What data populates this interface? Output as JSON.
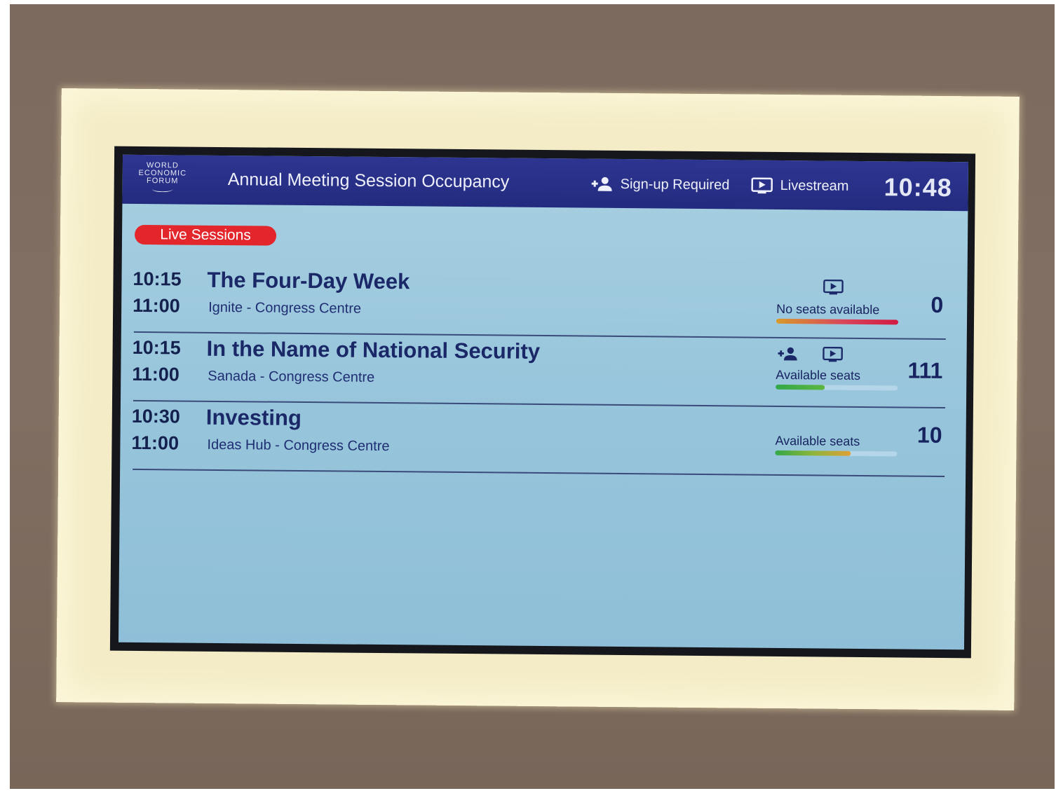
{
  "header": {
    "logo_lines": [
      "WORLD",
      "ECONOMIC",
      "FORUM"
    ],
    "title": "Annual Meeting Session Occupancy",
    "legend": [
      {
        "icon": "add-person-icon",
        "label": "Sign-up Required"
      },
      {
        "icon": "livestream-icon",
        "label": "Livestream"
      }
    ],
    "clock": "10:48"
  },
  "badge": {
    "label": "Live Sessions"
  },
  "sessions": [
    {
      "start": "10:15",
      "end": "11:00",
      "title": "The Four-Day Week",
      "venue": "Ignite - Congress Centre",
      "signup_required": false,
      "livestream": true,
      "seats_label": "No seats available",
      "seats": "0",
      "occupancy": 1.0
    },
    {
      "start": "10:15",
      "end": "11:00",
      "title": "In the Name of National Security",
      "venue": "Sanada - Congress Centre",
      "signup_required": true,
      "livestream": true,
      "seats_label": "Available seats",
      "seats": "111",
      "occupancy": 0.4
    },
    {
      "start": "10:30",
      "end": "11:00",
      "title": "Investing",
      "venue": "Ideas Hub - Congress Centre",
      "signup_required": false,
      "livestream": false,
      "seats_label": "Available seats",
      "seats": "10",
      "occupancy": 0.62
    }
  ],
  "colors": {
    "header_bg": "#232b7f",
    "screen_bg": "#9fcadf",
    "live_badge": "#e2262c",
    "text_dark": "#16235f",
    "occupancy_full": "#d11a42",
    "occupancy_available": "#33a84a",
    "occupancy_warning": "#e0a037"
  }
}
